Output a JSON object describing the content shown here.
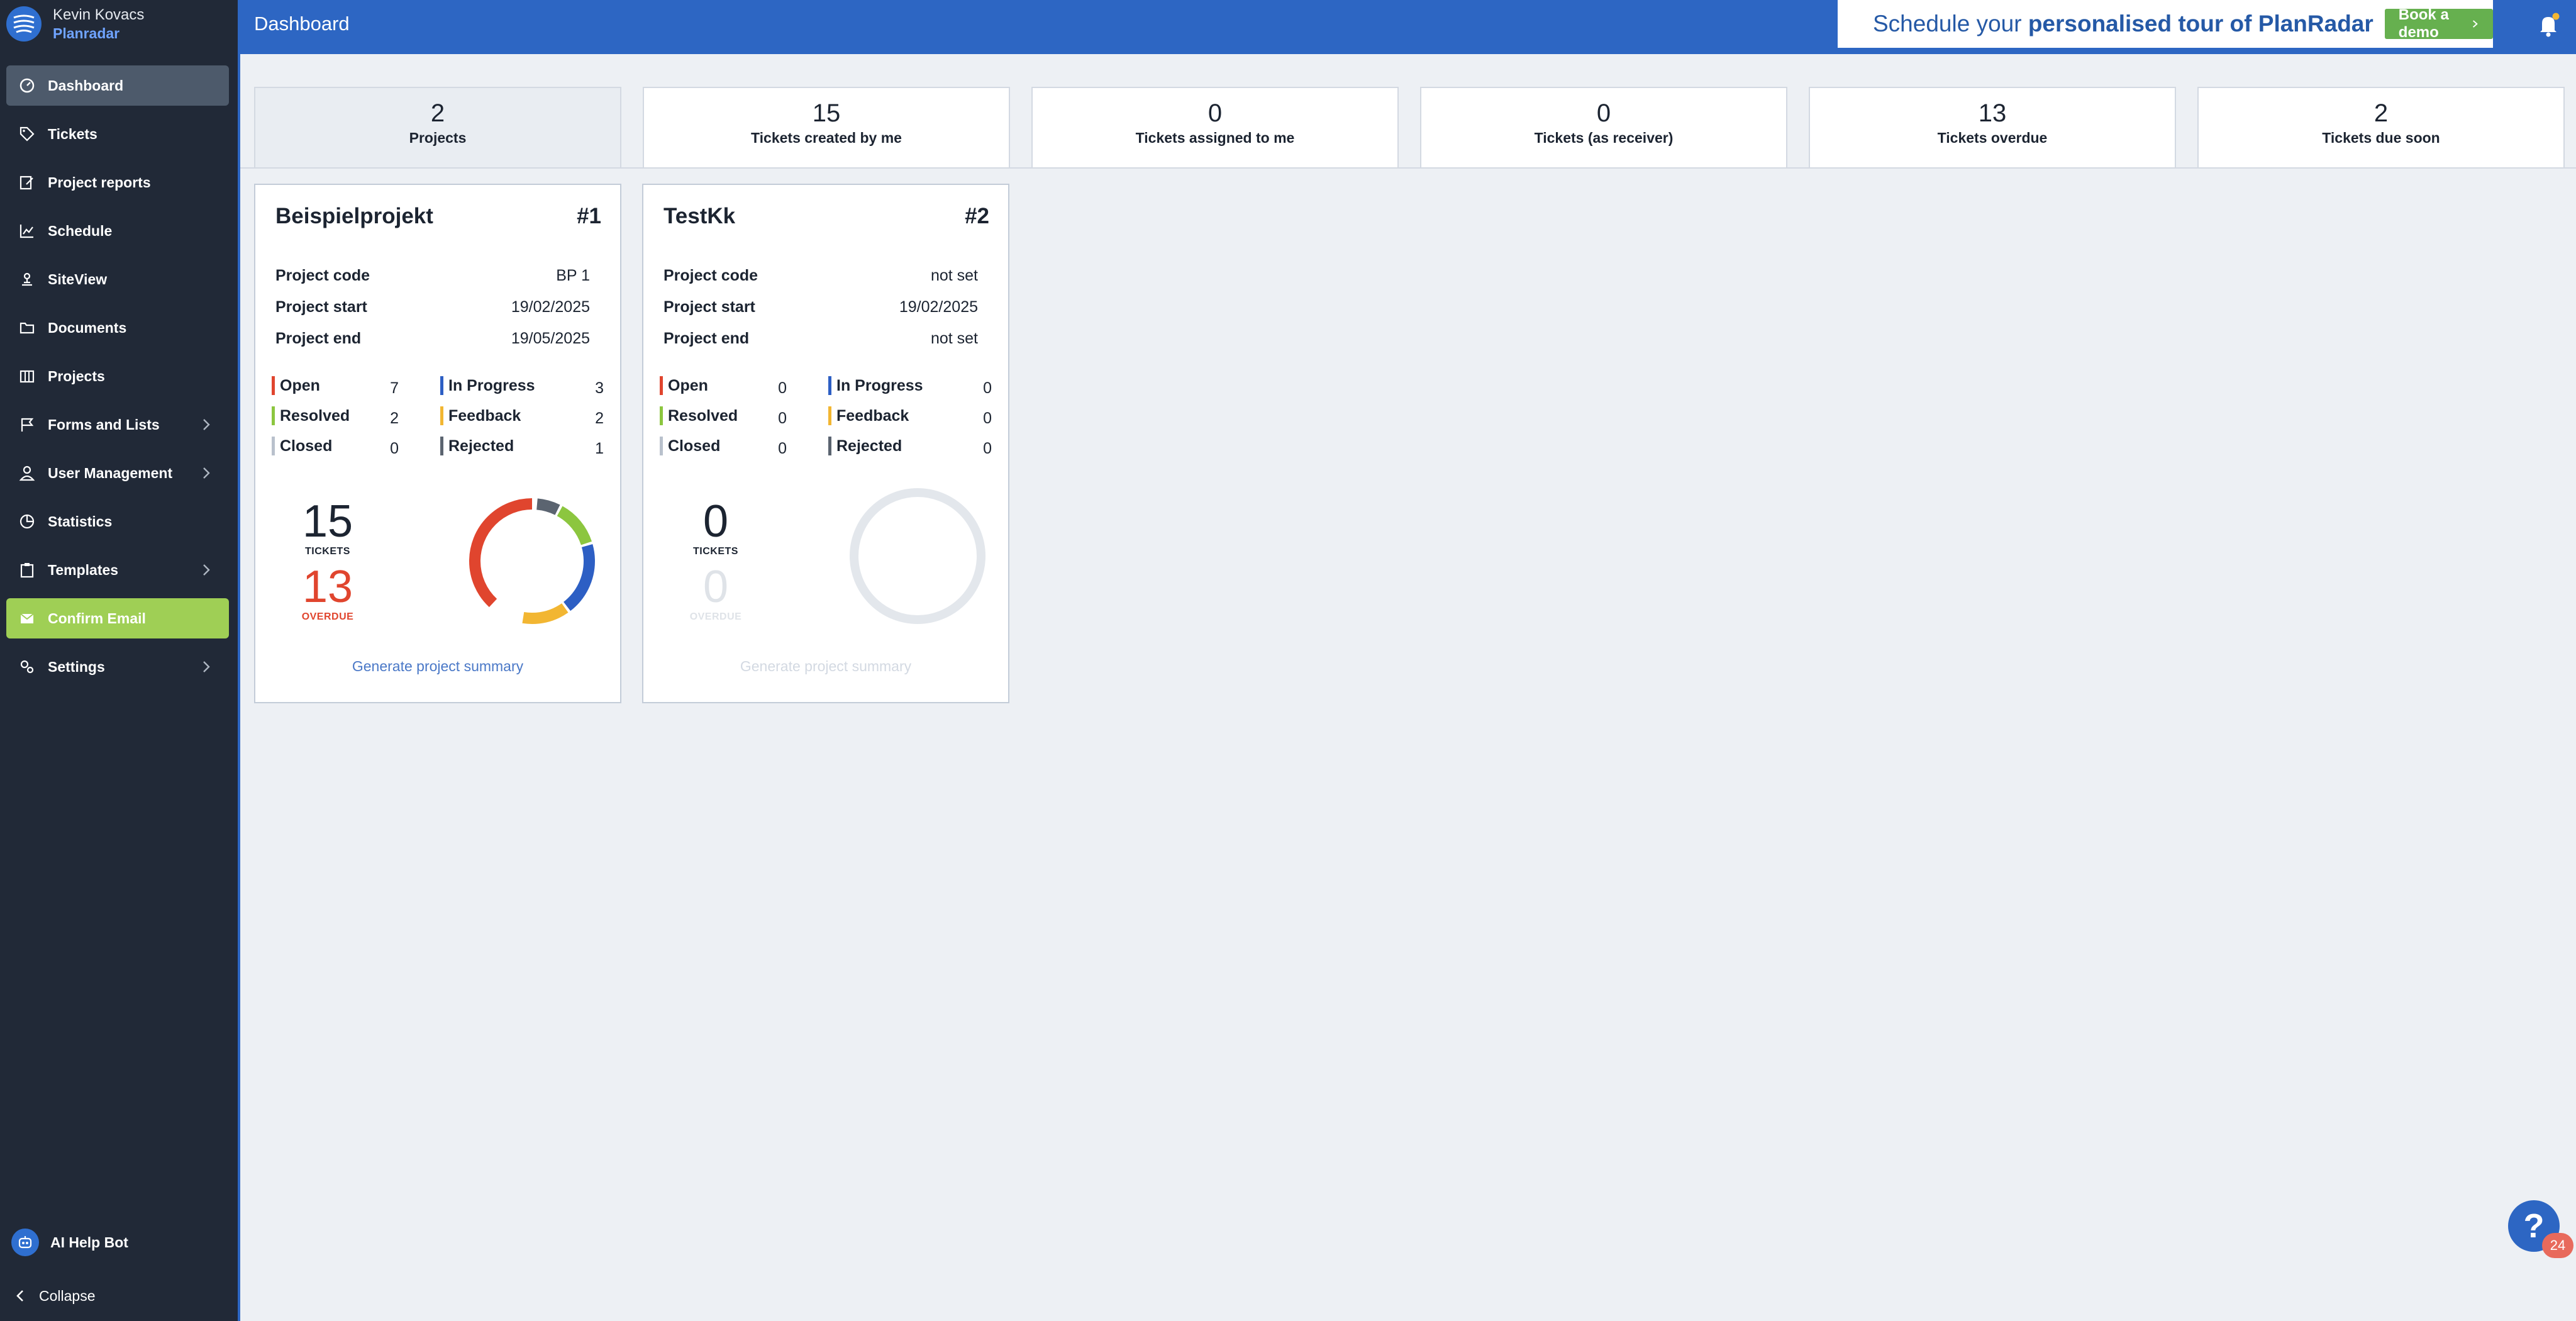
{
  "user": {
    "name": "Kevin Kovacs",
    "org": "Planradar"
  },
  "sidebar": {
    "items": [
      {
        "label": "Dashboard",
        "icon": "dashboard-icon"
      },
      {
        "label": "Tickets",
        "icon": "tag-icon"
      },
      {
        "label": "Project reports",
        "icon": "report-icon"
      },
      {
        "label": "Schedule",
        "icon": "schedule-icon"
      },
      {
        "label": "SiteView",
        "icon": "siteview-icon"
      },
      {
        "label": "Documents",
        "icon": "folder-icon"
      },
      {
        "label": "Projects",
        "icon": "projects-icon"
      },
      {
        "label": "Forms and Lists",
        "icon": "flag-icon"
      },
      {
        "label": "User Management",
        "icon": "user-icon"
      },
      {
        "label": "Statistics",
        "icon": "statistics-icon"
      },
      {
        "label": "Templates",
        "icon": "clipboard-icon"
      },
      {
        "label": "Confirm Email",
        "icon": "mail-icon"
      },
      {
        "label": "Settings",
        "icon": "settings-icon"
      }
    ],
    "ai_help": "AI Help Bot",
    "collapse": "Collapse"
  },
  "header": {
    "title": "Dashboard",
    "promo_prefix": "Schedule your ",
    "promo_bold": "personalised tour of PlanRadar",
    "demo_button": "Book a demo"
  },
  "stats": [
    {
      "value": "2",
      "label": "Projects"
    },
    {
      "value": "15",
      "label": "Tickets created by me"
    },
    {
      "value": "0",
      "label": "Tickets assigned to me"
    },
    {
      "value": "0",
      "label": "Tickets (as receiver)"
    },
    {
      "value": "13",
      "label": "Tickets overdue"
    },
    {
      "value": "2",
      "label": "Tickets due soon"
    }
  ],
  "labels": {
    "project_code": "Project code",
    "project_start": "Project start",
    "project_end": "Project end",
    "open": "Open",
    "in_progress": "In Progress",
    "resolved": "Resolved",
    "feedback": "Feedback",
    "closed": "Closed",
    "rejected": "Rejected",
    "tickets": "TICKETS",
    "overdue": "OVERDUE",
    "summary_link": "Generate project summary"
  },
  "projects": [
    {
      "name": "Beispielprojekt",
      "number": "#1",
      "code": "BP 1",
      "start": "19/02/2025",
      "end": "19/05/2025",
      "open": "7",
      "in_progress": "3",
      "resolved": "2",
      "feedback": "2",
      "closed": "0",
      "rejected": "1",
      "tickets": "15",
      "overdue": "13"
    },
    {
      "name": "TestKk",
      "number": "#2",
      "code": "not set",
      "start": "19/02/2025",
      "end": "not set",
      "open": "0",
      "in_progress": "0",
      "resolved": "0",
      "feedback": "0",
      "closed": "0",
      "rejected": "0",
      "tickets": "0",
      "overdue": "0"
    }
  ],
  "help": {
    "label": "?",
    "badge": "24"
  },
  "colors": {
    "open": "#e0452e",
    "in_progress": "#2d5fc4",
    "resolved": "#8cc63f",
    "feedback": "#f2b632",
    "closed": "#b9c1cc",
    "rejected": "#5b6470",
    "brand": "#2d66c3",
    "sidebar": "#212937"
  }
}
